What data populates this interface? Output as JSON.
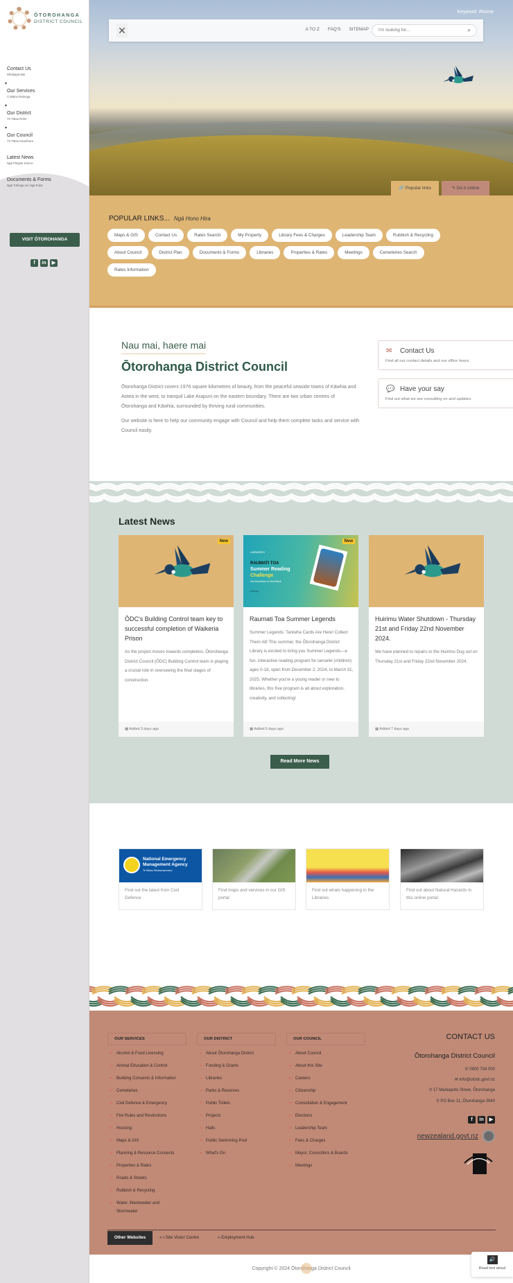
{
  "sidebar": {
    "logo": {
      "line1": "ŌTOROHANGA",
      "line2": "DISTRICT COUNCIL"
    },
    "nav": [
      {
        "label": "Contact Us",
        "sub": "Whakapā Mai",
        "has_caret": false
      },
      {
        "label": "Our Services",
        "sub": "Ā Mātou Ratonga",
        "has_caret": true
      },
      {
        "label": "Our District",
        "sub": "Tō Tātau Rohe",
        "has_caret": true
      },
      {
        "label": "Our Council",
        "sub": "Tō Tātau Kaunihera",
        "has_caret": true
      },
      {
        "label": "Latest News",
        "sub": "Ngā Pitopito Kōrero",
        "has_caret": false
      },
      {
        "label": "Documents & Forms",
        "sub": "Ngā Tuhinga me Ngā Puka",
        "has_caret": false
      }
    ],
    "caret": "▾",
    "visit_button": "VISIT ŌTOROHANGA",
    "social": {
      "facebook": "f",
      "linkedin": "in",
      "youtube": "▶"
    }
  },
  "header": {
    "keyword": "Keyword: #home",
    "close": "✕",
    "links": [
      "A TO Z",
      "FAQ'S",
      "SITEMAP"
    ],
    "search_placeholder": "I'm looking for...",
    "search_icon": "⌕"
  },
  "hero_tabs": {
    "popular": {
      "icon": "🔗",
      "label": "Popular links"
    },
    "online": {
      "icon": "✎",
      "label": "Do it online"
    }
  },
  "popular": {
    "title": "POPULAR LINKS...",
    "subtitle": "Ngā Hono Hira",
    "links": [
      "Maps & GIS",
      "Contact Us",
      "Rates Search",
      "My Property",
      "Library Fees & Charges",
      "Leadership Team",
      "Rubbish & Recycling",
      "About Council",
      "District Plan",
      "Documents & Forms",
      "Libraries",
      "Properties & Rates",
      "Meetings",
      "Cemeteries Search",
      "Rates Information"
    ]
  },
  "welcome": {
    "greeting": "Nau mai, haere mai",
    "title": "Ōtorohanga District Council",
    "paragraphs": [
      "Ōtorohanga District covers 1976 square kilometres of beauty, from the peaceful seaside towns of Kāwhia and Aotea in the west, to tranquil Lake Arapuni on the eastern boundary. There are two urban centres of Ōtorohanga and Kāwhia, surrounded by thriving rural communities.",
      "Our website is here to help our community engage with Council and help them complete tasks and service with Council easily."
    ]
  },
  "cta": [
    {
      "icon": "✉",
      "title": "Contact Us",
      "text": "Find all our contact details and our office hours."
    },
    {
      "icon": "💬",
      "title": "Have your say",
      "text": "Find out what we are consulting on and updates."
    }
  ],
  "news": {
    "heading": "Latest News",
    "badge": "New",
    "items": [
      {
        "title": "ŌDC's Building Control team key to successful completion of Waikeria Prison",
        "body": "As the project moves towards completion, Ōtorohanga District Council (ŌDC) Building Control team is playing a crucial role in overseeing the final stages of construction.",
        "added": "Added 3 days ago",
        "is_new": true,
        "image": "tui-bird"
      },
      {
        "title": "Raumati Toa Summer Legends",
        "body": "Summer Legends: Taniwha Cards Are Here! Collect Them All! This summer, the Ōtorohanga District Library is excited to bring you Summer Legends—a fun, interactive reading program for tamariki (children) ages 0-18, open from December 2, 2024, to March 31, 2025. Whether you're a young reader or new to libraries, this free program is all about exploration, creativity, and collecting!",
        "added": "Added 6 days ago",
        "is_new": true,
        "image": "summer-reading-poster",
        "poster": {
          "org": "LIBRARIES",
          "l1": "RAUMATI TOA",
          "l2": "Summer Reading",
          "l3": "Challenge",
          "l4": "2nd December to 31st March",
          "l5": "Library"
        }
      },
      {
        "title": "Huirimu Water Shutdown - Thursday 21st and Friday 22nd November 2024.",
        "body": "We have planned to repairs to the Huirimu Dug out on Thursday 21st and Friday 22nd November 2024.",
        "added": "Added 7 days ago",
        "is_new": false,
        "image": "tui-bird"
      }
    ],
    "read_more": "Read More News"
  },
  "quick_links": [
    {
      "image": "nema-logo",
      "img_text1": "National Emergency",
      "img_text2": "Management Agency",
      "img_text3": "Te Rākau Whakamarumaru",
      "text": "Find out the latest from Civil Defence"
    },
    {
      "image": "aerial-map",
      "text": "Find maps and services in our GIS portal"
    },
    {
      "image": "library-illustration",
      "text": "Find out whats happening in the Libraries"
    },
    {
      "image": "natural-hazards-photo",
      "text": "Find out about Natural Hazards in this online portal"
    }
  ],
  "footer": {
    "columns": [
      {
        "heading": "OUR SERVICES",
        "items": [
          "Alcohol & Food Licensing",
          "Animal Education & Control",
          "Building Consents & Information",
          "Cemeteries",
          "Civil Defence & Emergency",
          "Fire Rules and Restrictions",
          "Housing",
          "Maps & GIS",
          "Planning & Resource Consents",
          "Properties & Rates",
          "Roads & Streets",
          "Rubbish & Recycling",
          "Water, Wastewater and Stormwater"
        ]
      },
      {
        "heading": "OUR DISTRICT",
        "items": [
          "About Ōtorohanga District",
          "Funding & Grants",
          "Libraries",
          "Parks & Reserves",
          "Public Toilets",
          "Projects",
          "Halls",
          "Public Swimming Pool",
          "What's On"
        ]
      },
      {
        "heading": "OUR COUNCIL",
        "items": [
          "About Council",
          "About this Site",
          "Careers",
          "Citizenship",
          "Consultation & Engagement",
          "Elections",
          "Leadership Team",
          "Fees & Charges",
          "Mayor, Councillors & Boards",
          "Meetings"
        ]
      }
    ],
    "contact": {
      "heading": "CONTACT US",
      "org": "Ōtorohanga District Council",
      "phone": "0800 734 000",
      "email": "info@otodc.govt.nz",
      "address": "17 Maniapoto Street, Ōtorohanga",
      "po_box": "PO Box 11, Ōtorohanga 3940",
      "phone_icon": "✆",
      "email_icon": "✉",
      "pin_icon": "⚲"
    },
    "nzgovt": "newzealand.govt.nz",
    "other_websites": "Other Websites",
    "other_links": [
      "» i-Site Vistor Centre",
      "» Employment Hub"
    ]
  },
  "copyright": "Copyright © 2024 Ōtorohanga District Council",
  "read_aloud": {
    "icon": "🔊",
    "label": "Read text aloud"
  },
  "colors": {
    "green": "#3b5d4c",
    "gold": "#dfb574",
    "terracotta": "#c08a77",
    "sage": "#d1dbd6"
  }
}
